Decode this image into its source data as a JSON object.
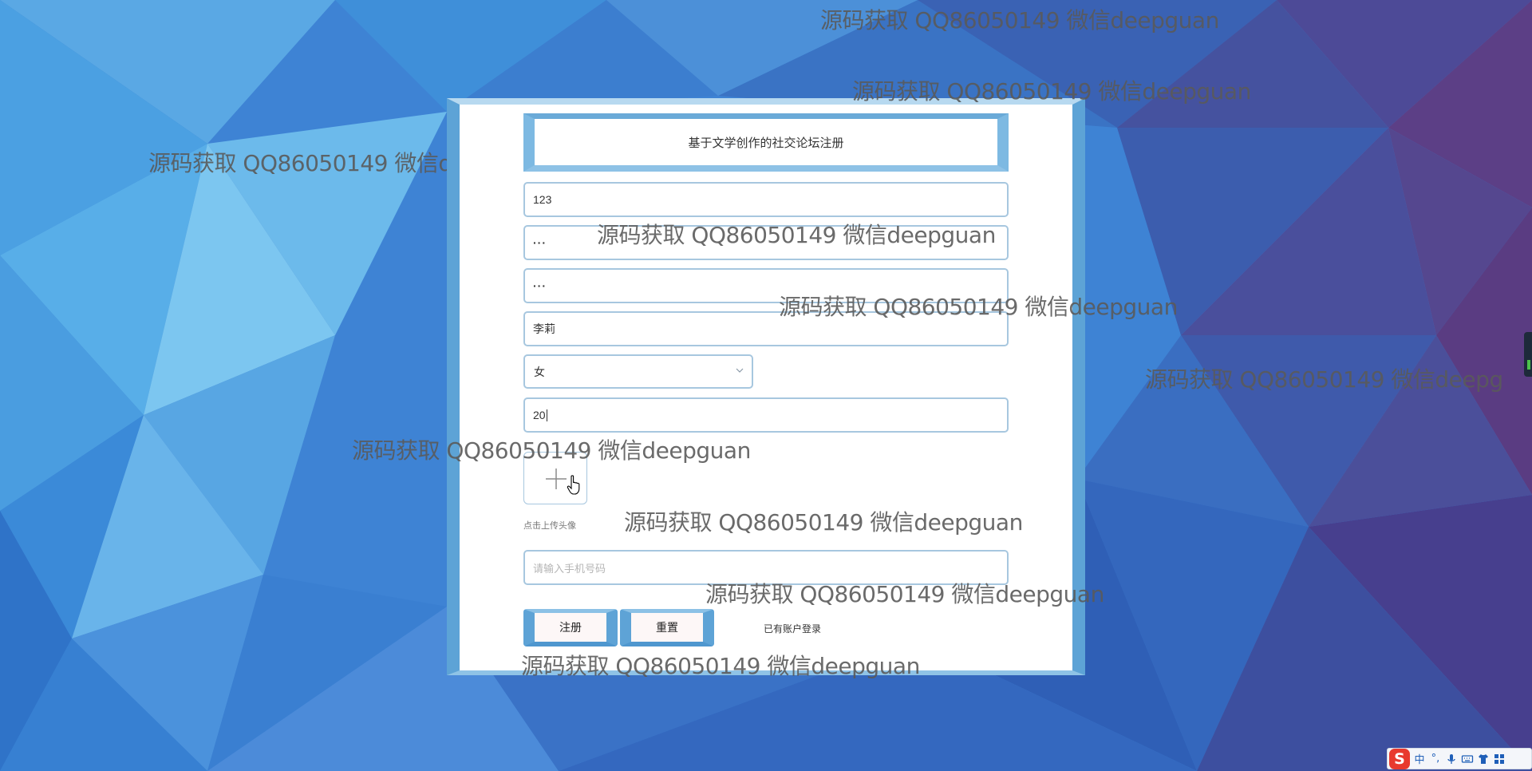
{
  "form": {
    "title": "基于文学创作的社交论坛注册",
    "username_value": "123",
    "password_value": "···",
    "confirm_password_value": "···",
    "name_value": "李莉",
    "gender_selected": "女",
    "age_value": "20",
    "upload_hint": "点击上传头像",
    "phone_placeholder": "请输入手机号码",
    "register_label": "注册",
    "reset_label": "重置",
    "login_link": "已有账户登录"
  },
  "watermark_text": "源码获取 QQ86050149 微信deepguan",
  "watermark_text_cut": "源码获取 QQ86050149 微信deepg",
  "ime_toolbar": {
    "logo": "S",
    "lang": "中",
    "punct": "°,",
    "icons": [
      "microphone-icon",
      "keyboard-icon",
      "skin-icon",
      "toolbox-icon"
    ]
  },
  "colors": {
    "background": "#3f7fd0",
    "frame": "#7cb6e0",
    "input_border": "#a7c7df"
  }
}
